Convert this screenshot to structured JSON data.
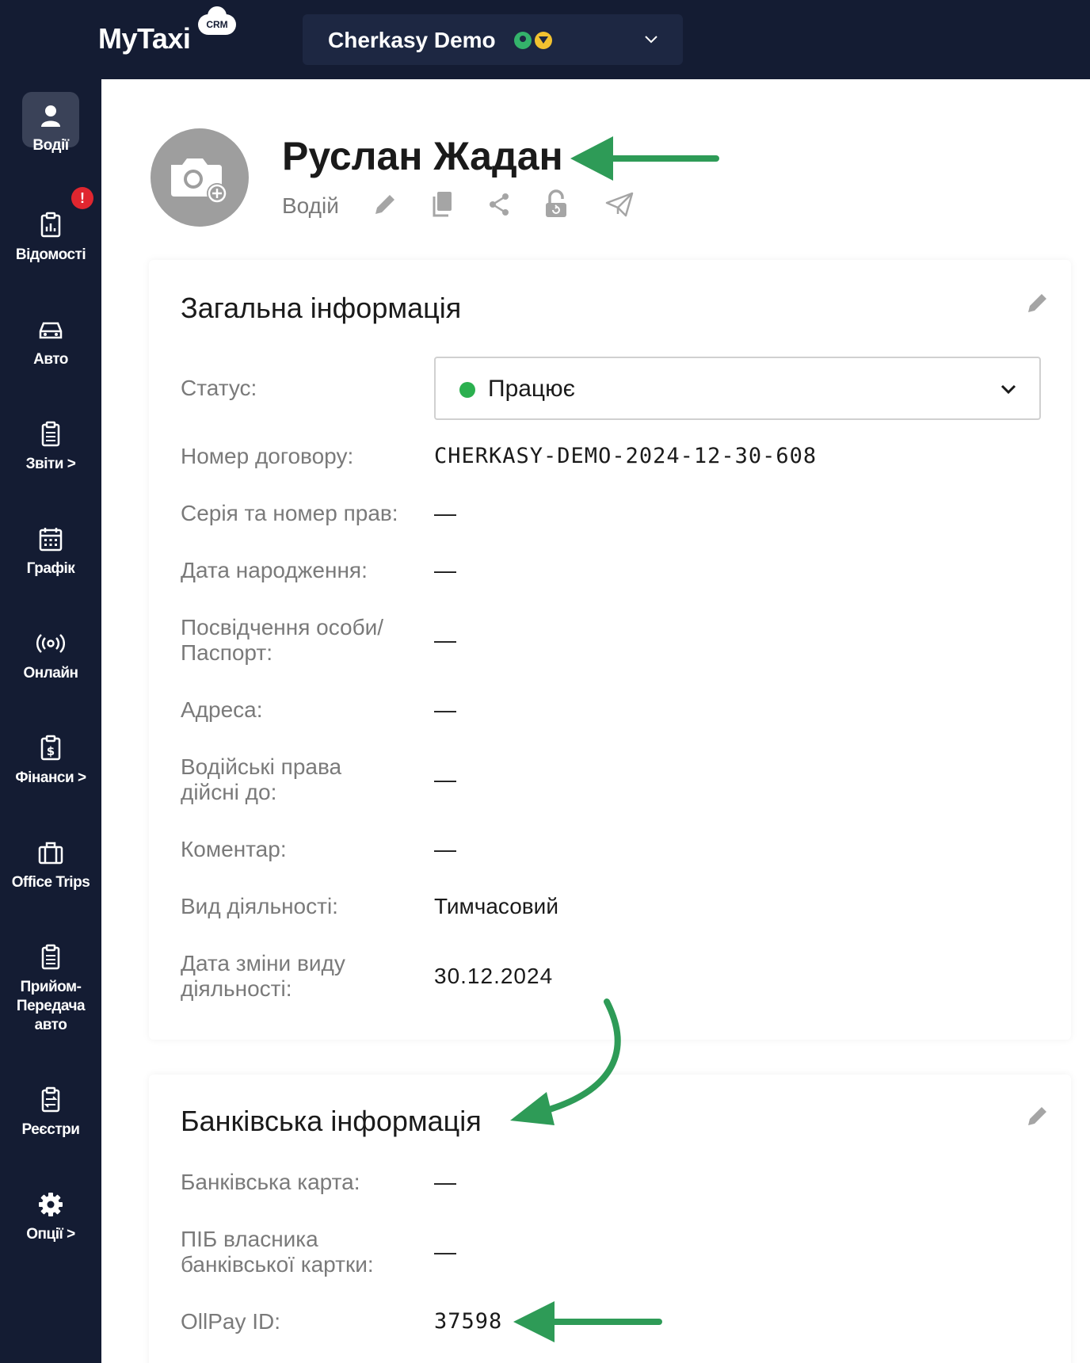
{
  "app": {
    "logo": "MyTaxi",
    "badge": "CRM"
  },
  "company": {
    "name": "Cherkasy Demo"
  },
  "sidebar": {
    "items": [
      {
        "label": "Водії",
        "icon": "user-icon"
      },
      {
        "label": "Відомості",
        "icon": "clipboard-chart-icon",
        "badge": "!"
      },
      {
        "label": "Авто",
        "icon": "car-icon"
      },
      {
        "label": "Звіти >",
        "icon": "document-icon"
      },
      {
        "label": "Графік",
        "icon": "calendar-icon"
      },
      {
        "label": "Онлайн",
        "icon": "broadcast-icon"
      },
      {
        "label": "Фінанси >",
        "icon": "finance-icon"
      },
      {
        "label": "Office Trips",
        "icon": "briefcase-icon"
      },
      {
        "label": "Прийом-",
        "label2": "Передача",
        "label3": "авто",
        "icon": "handover-icon"
      },
      {
        "label": "Реєстри",
        "icon": "registry-icon"
      },
      {
        "label": "Опції >",
        "icon": "gear-icon"
      }
    ]
  },
  "profile": {
    "name": "Руслан Жадан",
    "role": "Водій"
  },
  "general": {
    "title": "Загальна інформація",
    "status_label": "Статус:",
    "status_value": "Працює",
    "status_color": "#2bb04f",
    "rows": [
      {
        "label": "Номер договору:",
        "value": "CHERKASY-DEMO-2024-12-30-608"
      },
      {
        "label": "Серія та номер прав:",
        "value": "—"
      },
      {
        "label": "Дата народження:",
        "value": "—"
      },
      {
        "label": "Посвідчення особи/",
        "label2": "Паспорт:",
        "value": "—"
      },
      {
        "label": "Адреса:",
        "value": "—"
      },
      {
        "label": "Водійські права",
        "label2": "дійсні до:",
        "value": "—"
      },
      {
        "label": "Коментар:",
        "value": "—"
      },
      {
        "label": "Вид діяльності:",
        "value": "Тимчасовий"
      },
      {
        "label": "Дата зміни виду",
        "label2": "діяльності:",
        "value": "30.12.2024"
      }
    ]
  },
  "bank": {
    "title": "Банківська інформація",
    "rows": [
      {
        "label": "Банківська карта:",
        "value": "—"
      },
      {
        "label": "ПІБ власника",
        "label2": "банківської картки:",
        "value": "—"
      },
      {
        "label": "OllPay ID:",
        "value": "37598"
      }
    ]
  },
  "colors": {
    "sidebar_bg": "#141c33",
    "annotation_arrow": "#2e9b57"
  }
}
